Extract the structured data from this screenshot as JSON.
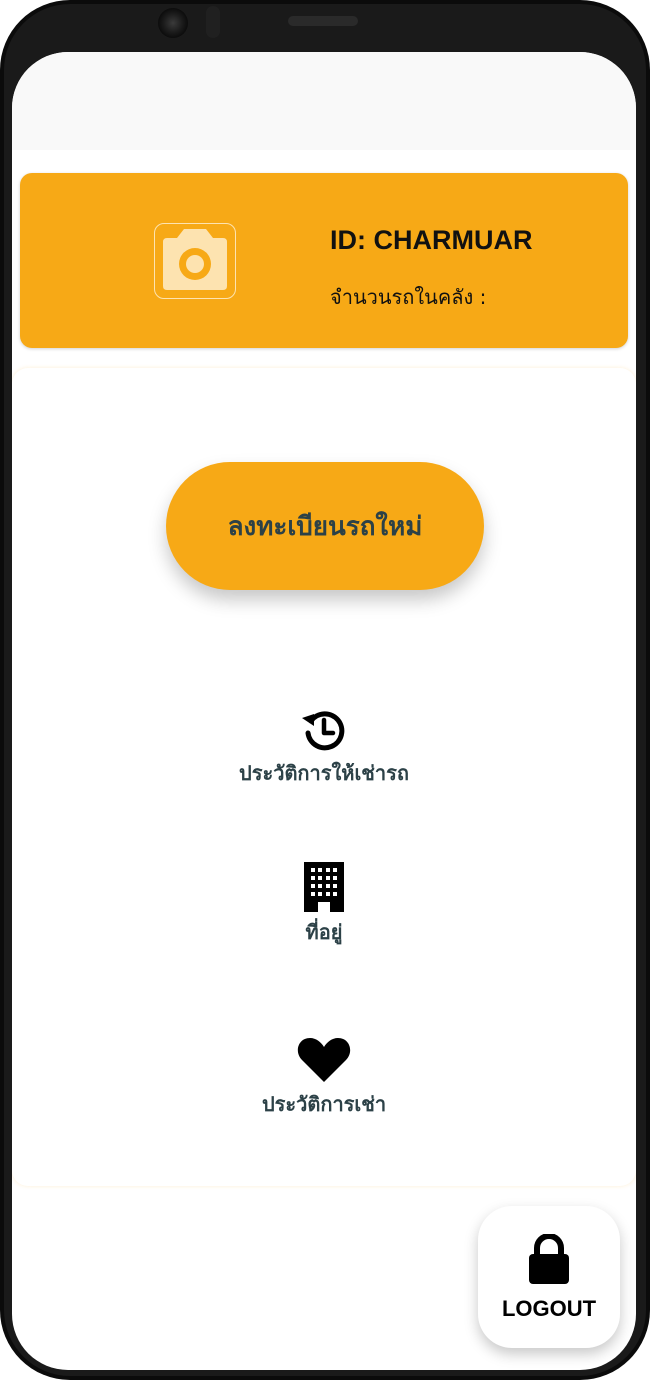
{
  "profile": {
    "id_text": "ID: CHARMUAR",
    "stock_label": "จำนวนรถในคลัง :",
    "avatar_icon": "camera-icon"
  },
  "actions": {
    "register_label": "ลงทะเบียนรถใหม่"
  },
  "menu": [
    {
      "label": "ประวัติการให้เช่ารถ",
      "icon": "history-icon"
    },
    {
      "label": "ที่อยู่",
      "icon": "building-icon"
    },
    {
      "label": "ประวัติการเช่า",
      "icon": "heart-icon"
    }
  ],
  "logout": {
    "label": "LOGOUT",
    "icon": "lock-icon"
  },
  "colors": {
    "accent": "#f7a916",
    "text_dark": "#2c4147",
    "background": "#ffffff"
  }
}
